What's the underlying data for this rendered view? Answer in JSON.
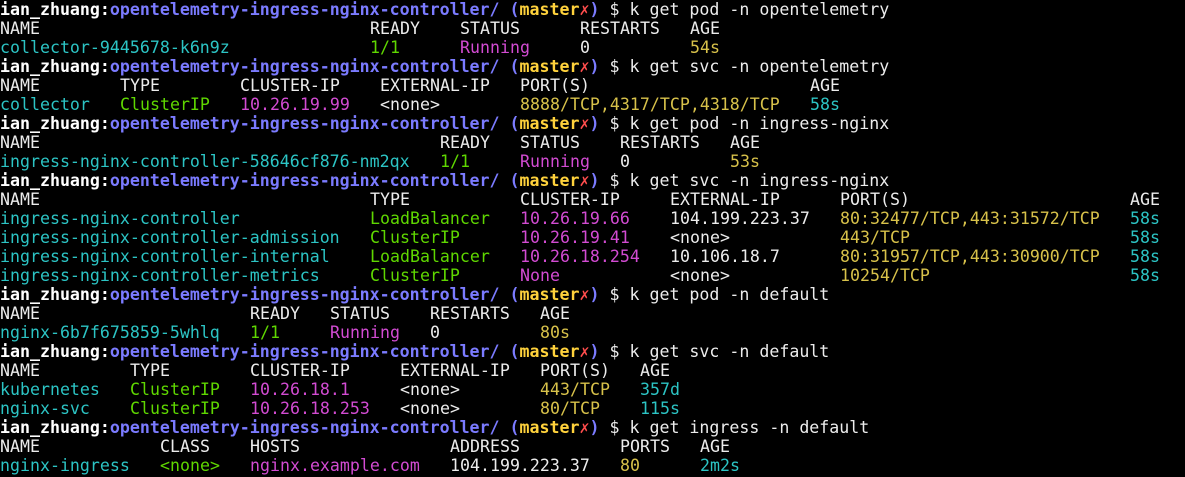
{
  "colors": {
    "background": "#000000",
    "prompt_path": "#7b7bff",
    "branch": "#ffd23c",
    "dirty_mark": "#ff4d4d",
    "name": "#2cc4c4",
    "type_ready": "#5fd700",
    "ip_status": "#d24bd2",
    "ports_age": "#d7c14a"
  },
  "prompt": {
    "user": "ian_zhuang",
    "sep": ":",
    "path": "opentelemetry-ingress-nginx-controller/",
    "paren_open": "(",
    "branch": "master",
    "dirty": "✗",
    "paren_close": ")",
    "dollar": "$"
  },
  "blocks": [
    {
      "command": "k get pod -n opentelemetry",
      "columns": [
        {
          "header": "NAME",
          "col": 0,
          "color": "c-cyan"
        },
        {
          "header": "READY",
          "col": 37,
          "color": "c-green"
        },
        {
          "header": "STATUS",
          "col": 46,
          "color": "c-magenta"
        },
        {
          "header": "RESTARTS",
          "col": 58,
          "color": "c-white"
        },
        {
          "header": "AGE",
          "col": 69,
          "color": "c-yellow"
        }
      ],
      "rows": [
        [
          "collector-9445678-k6n9z",
          "1/1",
          "Running",
          "0",
          "54s"
        ]
      ],
      "row_cols": [
        0,
        37,
        46,
        58,
        69
      ]
    },
    {
      "command": "k get svc -n opentelemetry",
      "columns": [
        {
          "header": "NAME",
          "col": 0,
          "color": "c-cyan"
        },
        {
          "header": "TYPE",
          "col": 12,
          "color": "c-green"
        },
        {
          "header": "CLUSTER-IP",
          "col": 24,
          "color": "c-magenta"
        },
        {
          "header": "EXTERNAL-IP",
          "col": 38,
          "color": "c-white"
        },
        {
          "header": "PORT(S)",
          "col": 52,
          "color": "c-yellow"
        },
        {
          "header": "AGE",
          "col": 81,
          "color": "c-cyan"
        }
      ],
      "rows": [
        [
          "collector",
          "ClusterIP",
          "10.26.19.99",
          "<none>",
          "8888/TCP,4317/TCP,4318/TCP",
          "58s"
        ]
      ],
      "row_cols": [
        0,
        12,
        24,
        38,
        52,
        81
      ]
    },
    {
      "command": "k get pod -n ingress-nginx",
      "columns": [
        {
          "header": "NAME",
          "col": 0,
          "color": "c-cyan"
        },
        {
          "header": "READY",
          "col": 44,
          "color": "c-green"
        },
        {
          "header": "STATUS",
          "col": 52,
          "color": "c-magenta"
        },
        {
          "header": "RESTARTS",
          "col": 62,
          "color": "c-white"
        },
        {
          "header": "AGE",
          "col": 73,
          "color": "c-yellow"
        }
      ],
      "rows": [
        [
          "ingress-nginx-controller-58646cf876-nm2qx",
          "1/1",
          "Running",
          "0",
          "53s"
        ]
      ],
      "row_cols": [
        0,
        44,
        52,
        62,
        73
      ]
    },
    {
      "command": "k get svc -n ingress-nginx",
      "columns": [
        {
          "header": "NAME",
          "col": 0,
          "color": "c-cyan"
        },
        {
          "header": "TYPE",
          "col": 37,
          "color": "c-green"
        },
        {
          "header": "CLUSTER-IP",
          "col": 52,
          "color": "c-magenta"
        },
        {
          "header": "EXTERNAL-IP",
          "col": 67,
          "color": "c-white"
        },
        {
          "header": "PORT(S)",
          "col": 84,
          "color": "c-yellow"
        },
        {
          "header": "AGE",
          "col": 113,
          "color": "c-cyan"
        }
      ],
      "rows": [
        [
          "ingress-nginx-controller",
          "LoadBalancer",
          "10.26.19.66",
          "104.199.223.37",
          "80:32477/TCP,443:31572/TCP",
          "58s"
        ],
        [
          "ingress-nginx-controller-admission",
          "ClusterIP",
          "10.26.19.41",
          "<none>",
          "443/TCP",
          "58s"
        ],
        [
          "ingress-nginx-controller-internal",
          "LoadBalancer",
          "10.26.18.254",
          "10.106.18.7",
          "80:31957/TCP,443:30900/TCP",
          "58s"
        ],
        [
          "ingress-nginx-controller-metrics",
          "ClusterIP",
          "None",
          "<none>",
          "10254/TCP",
          "58s"
        ]
      ],
      "row_cols": [
        0,
        37,
        52,
        67,
        84,
        113
      ]
    },
    {
      "command": "k get pod -n default",
      "columns": [
        {
          "header": "NAME",
          "col": 0,
          "color": "c-cyan"
        },
        {
          "header": "READY",
          "col": 25,
          "color": "c-green"
        },
        {
          "header": "STATUS",
          "col": 33,
          "color": "c-magenta"
        },
        {
          "header": "RESTARTS",
          "col": 43,
          "color": "c-white"
        },
        {
          "header": "AGE",
          "col": 54,
          "color": "c-yellow"
        }
      ],
      "rows": [
        [
          "nginx-6b7f675859-5whlq",
          "1/1",
          "Running",
          "0",
          "80s"
        ]
      ],
      "row_cols": [
        0,
        25,
        33,
        43,
        54
      ]
    },
    {
      "command": "k get svc -n default",
      "columns": [
        {
          "header": "NAME",
          "col": 0,
          "color": "c-cyan"
        },
        {
          "header": "TYPE",
          "col": 13,
          "color": "c-green"
        },
        {
          "header": "CLUSTER-IP",
          "col": 25,
          "color": "c-magenta"
        },
        {
          "header": "EXTERNAL-IP",
          "col": 40,
          "color": "c-white"
        },
        {
          "header": "PORT(S)",
          "col": 54,
          "color": "c-yellow"
        },
        {
          "header": "AGE",
          "col": 64,
          "color": "c-cyan"
        }
      ],
      "rows": [
        [
          "kubernetes",
          "ClusterIP",
          "10.26.18.1",
          "<none>",
          "443/TCP",
          "357d"
        ],
        [
          "nginx-svc",
          "ClusterIP",
          "10.26.18.253",
          "<none>",
          "80/TCP",
          "115s"
        ]
      ],
      "row_cols": [
        0,
        13,
        25,
        40,
        54,
        64
      ]
    },
    {
      "command": "k get ingress -n default",
      "columns": [
        {
          "header": "NAME",
          "col": 0,
          "color": "c-cyan"
        },
        {
          "header": "CLASS",
          "col": 16,
          "color": "c-green"
        },
        {
          "header": "HOSTS",
          "col": 25,
          "color": "c-magenta"
        },
        {
          "header": "ADDRESS",
          "col": 45,
          "color": "c-white"
        },
        {
          "header": "PORTS",
          "col": 62,
          "color": "c-yellow"
        },
        {
          "header": "AGE",
          "col": 70,
          "color": "c-cyan"
        }
      ],
      "rows": [
        [
          "nginx-ingress",
          "<none>",
          "nginx.example.com",
          "104.199.223.37",
          "80",
          "2m2s"
        ]
      ],
      "row_cols": [
        0,
        16,
        25,
        45,
        62,
        70
      ]
    }
  ]
}
